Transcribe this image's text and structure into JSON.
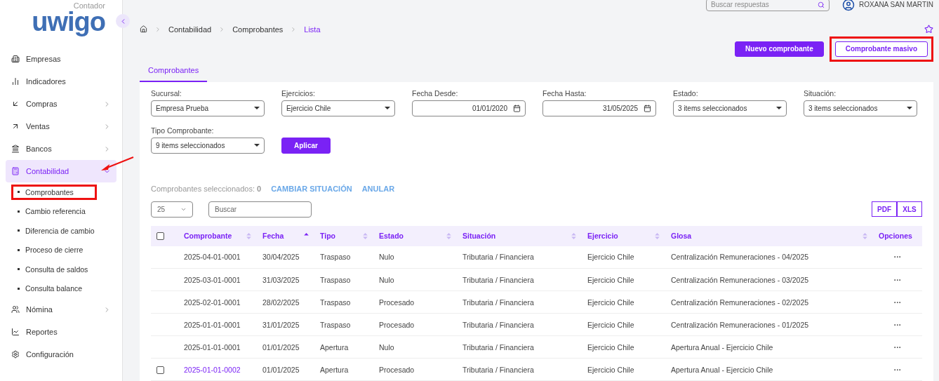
{
  "header": {
    "search": {
      "placeholder": "Buscar respuestas"
    },
    "user": "ROXANA SAN MARTIN"
  },
  "logo": {
    "wordmark": "uwigo",
    "tagline": "Contador"
  },
  "sidebar": {
    "items": [
      {
        "label": "Empresas",
        "kind": "building",
        "expandable": false,
        "selected": false
      },
      {
        "label": "Indicadores",
        "kind": "bars",
        "expandable": false,
        "selected": false
      },
      {
        "label": "Compras",
        "kind": "purchases",
        "expandable": true,
        "selected": false
      },
      {
        "label": "Ventas",
        "kind": "sales",
        "expandable": true,
        "selected": false
      },
      {
        "label": "Bancos",
        "kind": "bank",
        "expandable": true,
        "selected": false
      },
      {
        "label": "Contabilidad",
        "kind": "accounting",
        "expandable": true,
        "selected": true,
        "expanded": true,
        "children": [
          {
            "label": "Comprobantes",
            "selected": true
          },
          {
            "label": "Cambio referencia",
            "selected": false
          },
          {
            "label": "Diferencia de cambio",
            "selected": false
          },
          {
            "label": "Proceso de cierre",
            "selected": false
          },
          {
            "label": "Consulta de saldos",
            "selected": false
          },
          {
            "label": "Consulta balance",
            "selected": false
          }
        ]
      },
      {
        "label": "Nómina",
        "kind": "payroll",
        "expandable": true,
        "selected": false
      },
      {
        "label": "Reportes",
        "kind": "reports",
        "expandable": false,
        "selected": false
      },
      {
        "label": "Configuración",
        "kind": "settings",
        "expandable": false,
        "selected": false
      }
    ]
  },
  "breadcrumb": [
    "Contabilidad",
    "Comprobantes",
    "Lista"
  ],
  "actions": [
    {
      "label": "Nuevo comprobante",
      "kind": "primary"
    },
    {
      "label": "Comprobante masivo",
      "kind": "outline"
    }
  ],
  "tabs": [
    {
      "label": "Comprobantes",
      "selected": true
    }
  ],
  "filters": [
    {
      "label": "Sucursal:",
      "value": "Empresa Prueba",
      "kind": "select"
    },
    {
      "label": "Ejercicios:",
      "value": "Ejercicio Chile",
      "kind": "select"
    },
    {
      "label": "Fecha Desde:",
      "value": "01/01/2020",
      "kind": "date"
    },
    {
      "label": "Fecha Hasta:",
      "value": "31/05/2025",
      "kind": "date"
    },
    {
      "label": "Estado:",
      "value": "3 items seleccionados",
      "kind": "select"
    },
    {
      "label": "Situación:",
      "value": "3 items seleccionados",
      "kind": "select"
    },
    {
      "label": "Tipo Comprobante:",
      "value": "9 items seleccionados",
      "kind": "select"
    }
  ],
  "apply_button": "Aplicar",
  "selection": {
    "label": "Comprobantes seleccionados:",
    "count": "0",
    "actions": [
      "CAMBIAR SITUACIÓN",
      "ANULAR"
    ]
  },
  "page_size": "25",
  "table_search": {
    "placeholder": "Buscar"
  },
  "exports": [
    "PDF",
    "XLS"
  ],
  "table": {
    "header_checkbox": {
      "checked": false
    },
    "columns": [
      {
        "label": "Comprobante",
        "sortable": true,
        "sorted": false
      },
      {
        "label": "Fecha",
        "sortable": true,
        "sorted": true
      },
      {
        "label": "Tipo",
        "sortable": true,
        "sorted": false
      },
      {
        "label": "Estado",
        "sortable": true,
        "sorted": false
      },
      {
        "label": "Situación",
        "sortable": true,
        "sorted": false
      },
      {
        "label": "Ejercicio",
        "sortable": true,
        "sorted": false
      },
      {
        "label": "Glosa",
        "sortable": true,
        "sorted": false
      },
      {
        "label": "Opciones",
        "sortable": false
      }
    ],
    "rows": [
      {
        "has_checkbox": false,
        "link": false,
        "cells": [
          "2025-04-01-0001",
          "30/04/2025",
          "Traspaso",
          "Nulo",
          "Tributaria / Financiera",
          "Ejercicio Chile",
          "Centralización Remuneraciones - 04/2025"
        ],
        "options": "···"
      },
      {
        "has_checkbox": false,
        "link": false,
        "cells": [
          "2025-03-01-0001",
          "31/03/2025",
          "Traspaso",
          "Nulo",
          "Tributaria / Financiera",
          "Ejercicio Chile",
          "Centralización Remuneraciones - 03/2025"
        ],
        "options": "···"
      },
      {
        "has_checkbox": false,
        "link": false,
        "cells": [
          "2025-02-01-0001",
          "28/02/2025",
          "Traspaso",
          "Procesado",
          "Tributaria / Financiera",
          "Ejercicio Chile",
          "Centralización Remuneraciones - 02/2025"
        ],
        "options": "···"
      },
      {
        "has_checkbox": false,
        "link": false,
        "cells": [
          "2025-01-01-0001",
          "31/01/2025",
          "Traspaso",
          "Procesado",
          "Tributaria / Financiera",
          "Ejercicio Chile",
          "Centralización Remuneraciones - 01/2025"
        ],
        "options": "···"
      },
      {
        "has_checkbox": false,
        "link": false,
        "cells": [
          "2025-01-01-0001",
          "01/01/2025",
          "Apertura",
          "Nulo",
          "Tributaria / Financiera",
          "Ejercicio Chile",
          "Apertura Anual - Ejercicio Chile"
        ],
        "options": "···"
      },
      {
        "has_checkbox": true,
        "checked": false,
        "link": true,
        "cells": [
          "2025-01-01-0002",
          "01/01/2025",
          "Apertura",
          "Procesado",
          "Tributaria / Financiera",
          "Ejercicio Chile",
          "Apertura Anual - Ejercicio Chile"
        ],
        "options": "···"
      }
    ]
  }
}
